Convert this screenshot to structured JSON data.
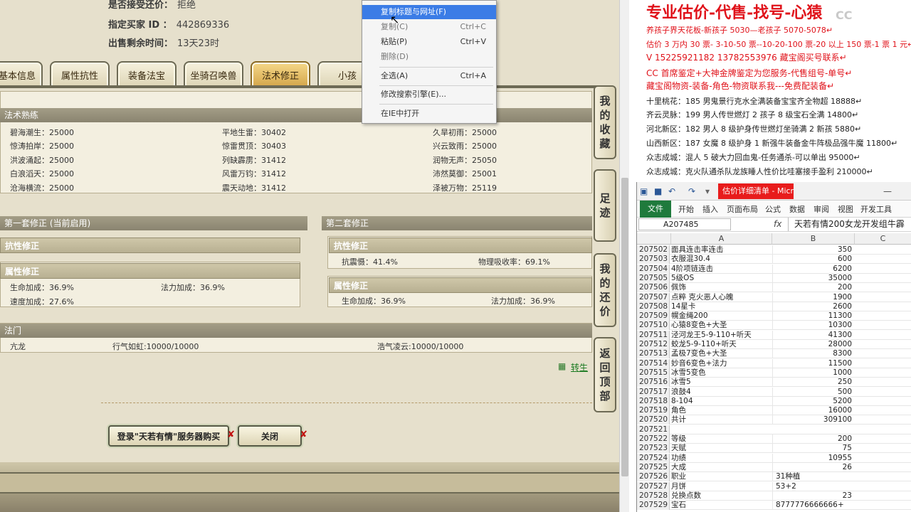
{
  "game": {
    "info": {
      "accept_counter_label": "是否接受还价：",
      "accept_counter_value": "拒绝",
      "buyer_id_label": "指定买家 ID ：",
      "buyer_id_value": "442869336",
      "time_left_label": "出售剩余时间：",
      "time_left_value": "13天23时"
    },
    "tabs": [
      {
        "label": "基本信息"
      },
      {
        "label": "属性抗性"
      },
      {
        "label": "装备法宝"
      },
      {
        "label": "坐骑召唤兽"
      },
      {
        "label": "法术修正"
      },
      {
        "label": "小孩"
      }
    ],
    "proficiency": {
      "title": "法术熟练",
      "rows": [
        [
          "碧海潮生：25000",
          "平地生雷：30402",
          "久旱初雨：25000"
        ],
        [
          "惊涛拍岸：25000",
          "惊雷贯顶：30403",
          "兴云致雨：25000"
        ],
        [
          "洪波涌起：25000",
          "列缺霹雳：31412",
          "润物无声：25050"
        ],
        [
          "白浪滔天：25000",
          "风雷万钧：31412",
          "沛然莫御：25001"
        ],
        [
          "沧海横流：25000",
          "震天动地：31412",
          "泽被万物：25119"
        ]
      ]
    },
    "set1": {
      "title": "第一套修正 (当前启用)",
      "resist_title": "抗性修正",
      "attr_title": "属性修正",
      "attr_items": [
        "生命加成：36.9%",
        "法力加成：36.9%",
        "速度加成：27.6%"
      ]
    },
    "set2": {
      "title": "第二套修正",
      "resist_title": "抗性修正",
      "resist_items": [
        "抗震慑：41.4%",
        "物理吸收率：69.1%"
      ],
      "attr_title": "属性修正",
      "attr_items": [
        "生命加成：36.9%",
        "法力加成：36.9%"
      ]
    },
    "school": {
      "title": "法门",
      "items": [
        "亢龙",
        "行气如虹:10000/10000",
        "浩气凌云:10000/10000"
      ]
    },
    "transfer_link": "转生",
    "buttons": {
      "login_buy": "登录\"天若有情\"服务器购买",
      "close": "关闭",
      "x_mark": "✘"
    },
    "side_nav": [
      {
        "label": [
          "我",
          "的",
          "收",
          "藏"
        ]
      },
      {
        "label": [
          "足",
          "迹"
        ]
      },
      {
        "label": [
          "我",
          "的",
          "还",
          "价"
        ]
      },
      {
        "label": [
          "返",
          "回",
          "顶",
          "部"
        ]
      }
    ],
    "context_menu": [
      {
        "label": "复制标题与网址(F)",
        "shortcut": "",
        "highlighted": true,
        "dim": false
      },
      {
        "label": "复制(C)",
        "shortcut": "Ctrl+C",
        "highlighted": false,
        "dim": true
      },
      {
        "label": "粘贴(P)",
        "shortcut": "Ctrl+V",
        "highlighted": false,
        "dim": false
      },
      {
        "label": "删除(D)",
        "shortcut": "",
        "highlighted": false,
        "dim": true
      },
      {
        "label": "全选(A)",
        "shortcut": "Ctrl+A",
        "highlighted": false,
        "dim": false
      },
      {
        "label": "修改搜索引擎(E)...",
        "shortcut": "",
        "highlighted": false,
        "dim": false
      },
      {
        "label": "在IE中打开",
        "shortcut": "",
        "highlighted": false,
        "dim": false
      }
    ]
  },
  "doc": {
    "title": "专业估价-代售-找号-心猿",
    "logo": "CC",
    "lines": [
      {
        "text": "养孩子界天花板-新孩子 5030—老孩子 5070-5078↵",
        "red": true
      },
      {
        "text": "估价 3 万内 30 票- 3-10-50 票--10-20-100 票-20 以上 150 票-1 票 1 元↵",
        "red": true
      },
      {
        "text": "V 15225921182      13782553976    藏宝阁买号联系↵",
        "red": true
      },
      {
        "text": "CC 首席鉴定+大神金牌鉴定为您服务-代售组号-单号↵",
        "red": true
      },
      {
        "text": "藏宝阁物资-装备-角色-物资联系我---免费配装备↵",
        "red": true
      },
      {
        "text": "十里桃花：185 男鬼景行克水全满装备宝宝齐全物超 18888↵",
        "red": false
      },
      {
        "text": "齐云灵脉：199 男人传世燃灯 2 孩子 8 级宝石全满 14800↵",
        "red": false
      },
      {
        "text": "河北新区：182 男人 8 级护身传世燃灯坐骑满 2 新孩 5880↵",
        "red": false
      },
      {
        "text": "山西新区：187 女魔 8 级护身 1 新强牛装备金牛阵极品强牛魔 11800↵",
        "red": false
      },
      {
        "text": "众志成城：混人 5 破大力回血鬼-任务通杀-可以单出 95000↵",
        "red": false
      },
      {
        "text": "众志成城：克火队通杀队龙族睡人性价比哇塞接手盈利 210000↵",
        "red": false
      }
    ]
  },
  "excel": {
    "window_title": "估价详细清单 - Microsoft Excel(产品...",
    "ribbon_tabs": [
      "文件",
      "开始",
      "插入",
      "页面布局",
      "公式",
      "数据",
      "审阅",
      "视图",
      "开发工具"
    ],
    "name_box": "A207485",
    "fx": "fx",
    "formula": "天若有情200女龙开发组牛霹",
    "col_headers": [
      "A",
      "B",
      "C"
    ],
    "rows": [
      {
        "n": "207502",
        "a": "面具连击率连击",
        "b": "350"
      },
      {
        "n": "207503",
        "a": "衣服混30.4",
        "b": "600"
      },
      {
        "n": "207504",
        "a": "4阶项链连击",
        "b": "6200"
      },
      {
        "n": "207505",
        "a": "5级OS",
        "b": "35000"
      },
      {
        "n": "207506",
        "a": "佩饰",
        "b": "200"
      },
      {
        "n": "207507",
        "a": "点粹 克火恶人心魄",
        "b": "1900"
      },
      {
        "n": "207508",
        "a": "14星卡",
        "b": "2600"
      },
      {
        "n": "207509",
        "a": "幌金绳200",
        "b": "11300"
      },
      {
        "n": "207510",
        "a": "心猿8变色+大圣",
        "b": "10300"
      },
      {
        "n": "207511",
        "a": "泾河龙王5-9-110+听天",
        "b": "41300"
      },
      {
        "n": "207512",
        "a": "蛟龙5-9-110+听天",
        "b": "28000"
      },
      {
        "n": "207513",
        "a": "孟极7变色+大圣",
        "b": "8300"
      },
      {
        "n": "207514",
        "a": "妙音6变色+法力",
        "b": "11500"
      },
      {
        "n": "207515",
        "a": "冰雪5变色",
        "b": "1000"
      },
      {
        "n": "207516",
        "a": "冰雪5",
        "b": "250"
      },
      {
        "n": "207517",
        "a": "浪鼓4",
        "b": "500"
      },
      {
        "n": "207518",
        "a": "8-104",
        "b": "5200"
      },
      {
        "n": "207519",
        "a": "角色",
        "b": "16000"
      },
      {
        "n": "207520",
        "a": "共计",
        "b": "309100"
      },
      {
        "n": "207521",
        "a": "",
        "b": ""
      },
      {
        "n": "207522",
        "a": "等级",
        "b": "200"
      },
      {
        "n": "207523",
        "a": "天赋",
        "b": "75"
      },
      {
        "n": "207524",
        "a": "功绩",
        "b": "10955"
      },
      {
        "n": "207525",
        "a": "大成",
        "b": "26"
      },
      {
        "n": "207526",
        "a": "职业",
        "b": "31种植",
        "left": true
      },
      {
        "n": "207527",
        "a": "月饼",
        "b": "53+2",
        "left": true
      },
      {
        "n": "207528",
        "a": "兑换点数",
        "b": "23"
      },
      {
        "n": "207529",
        "a": "宝石",
        "b": "8777776666666+",
        "left": true
      }
    ]
  }
}
